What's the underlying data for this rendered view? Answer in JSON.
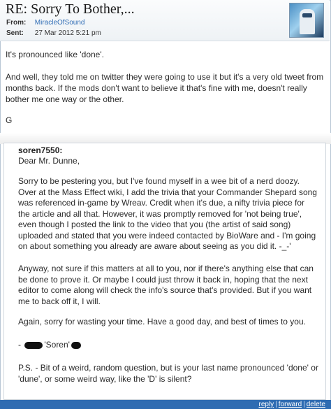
{
  "message": {
    "subject": "RE: Sorry To Bother,...",
    "from_label": "From:",
    "from_value": "MiracleOfSound",
    "sent_label": "Sent:",
    "sent_value": "27 Mar 2012 5:21 pm"
  },
  "reply_body": [
    "It's pronounced like 'done'.",
    "And well, they told me on twitter they were going to use it but it's a very old tweet from months back. If the mods don't want to believe it that's fine with me, doesn't really bother me one way or the other.",
    "G"
  ],
  "quote": {
    "author": "soren7550:",
    "greeting": "Dear Mr. Dunne,",
    "paragraph1": "Sorry to be pestering you, but I've found myself in a wee bit of a nerd doozy. Over at the Mass Effect wiki, I add the trivia that your Commander Shepard song was referenced in-game by Wreav. Credit when it's due, a nifty trivia piece for the article and all that. However, it was promptly removed for 'not being true', even though I posted the link to the video that you (the artist of said song) uploaded and stated that you were indeed contacted by BioWare and - I'm going on about something you already are aware about seeing as you did it. -_-'",
    "paragraph2": "Anyway, not sure if this matters at all to you, nor if there's anything else that can be done to prove it. Or maybe I could just throw it back in, hoping that the next editor to come along will check the info's source that's provided. But if you want me to back off it, I will.",
    "paragraph3": "Again, sorry for wasting your time. Have a good day, and best of times to you.",
    "signoff_prefix": "-",
    "signoff_name": "'Soren'",
    "postscript": "P.S. - Bit of a weird, random question, but is your last name pronounced 'done' or 'dune', or some weird way, like the 'D' is silent?"
  },
  "actions": {
    "reply": "reply",
    "forward": "forward",
    "delete": "delete",
    "separator": "|"
  }
}
